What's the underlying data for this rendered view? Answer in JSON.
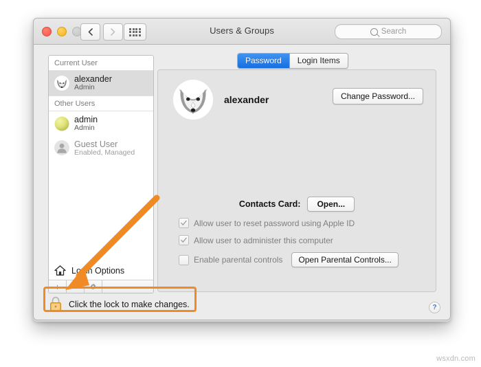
{
  "window": {
    "title": "Users & Groups",
    "traffic_lights": [
      "close",
      "minimize",
      "zoom"
    ],
    "nav": {
      "back_icon": "chevron-left-icon",
      "forward_icon": "chevron-right-icon",
      "grid_icon": "show-all-grid-icon"
    },
    "search": {
      "placeholder": "Search",
      "icon": "search-icon"
    }
  },
  "tabs": [
    {
      "label": "Password",
      "active": true
    },
    {
      "label": "Login Items",
      "active": false
    }
  ],
  "sidebar": {
    "current_user_header": "Current User",
    "other_users_header": "Other Users",
    "current_user": {
      "name": "alexander",
      "role": "Admin",
      "avatar": "fox-avatar",
      "selected": true
    },
    "other_users": [
      {
        "name": "admin",
        "role": "Admin",
        "avatar": "yellow-sphere-avatar",
        "disabled": false
      },
      {
        "name": "Guest User",
        "role": "Enabled, Managed",
        "avatar": "guest-person-avatar",
        "disabled": true
      }
    ],
    "login_options": {
      "label": "Login Options",
      "icon": "house-icon"
    },
    "buttons": [
      {
        "label": "+",
        "name": "add-user-button"
      },
      {
        "label": "−",
        "name": "remove-user-button"
      },
      {
        "label": "gear",
        "name": "user-options-gear-button"
      }
    ]
  },
  "main": {
    "user_name": "alexander",
    "avatar": "fox-avatar",
    "change_password_label": "Change Password...",
    "contacts_card_label": "Contacts Card:",
    "contacts_open_label": "Open...",
    "options": [
      {
        "label": "Allow user to reset password using Apple ID",
        "checked": true,
        "disabled": true
      },
      {
        "label": "Allow user to administer this computer",
        "checked": true,
        "disabled": true
      },
      {
        "label": "Enable parental controls",
        "checked": false,
        "disabled": true
      }
    ],
    "parental_button_label": "Open Parental Controls...",
    "help_label": "?"
  },
  "footer": {
    "lock_text": "Click the lock to make changes.",
    "lock_icon": "closed-padlock-icon"
  },
  "annotation": {
    "highlight_color": "#f08a24",
    "arrow_color": "#f08a24",
    "arrow_description": "orange-arrow-pointing-to-lock"
  },
  "watermark": "wsxdn.com"
}
